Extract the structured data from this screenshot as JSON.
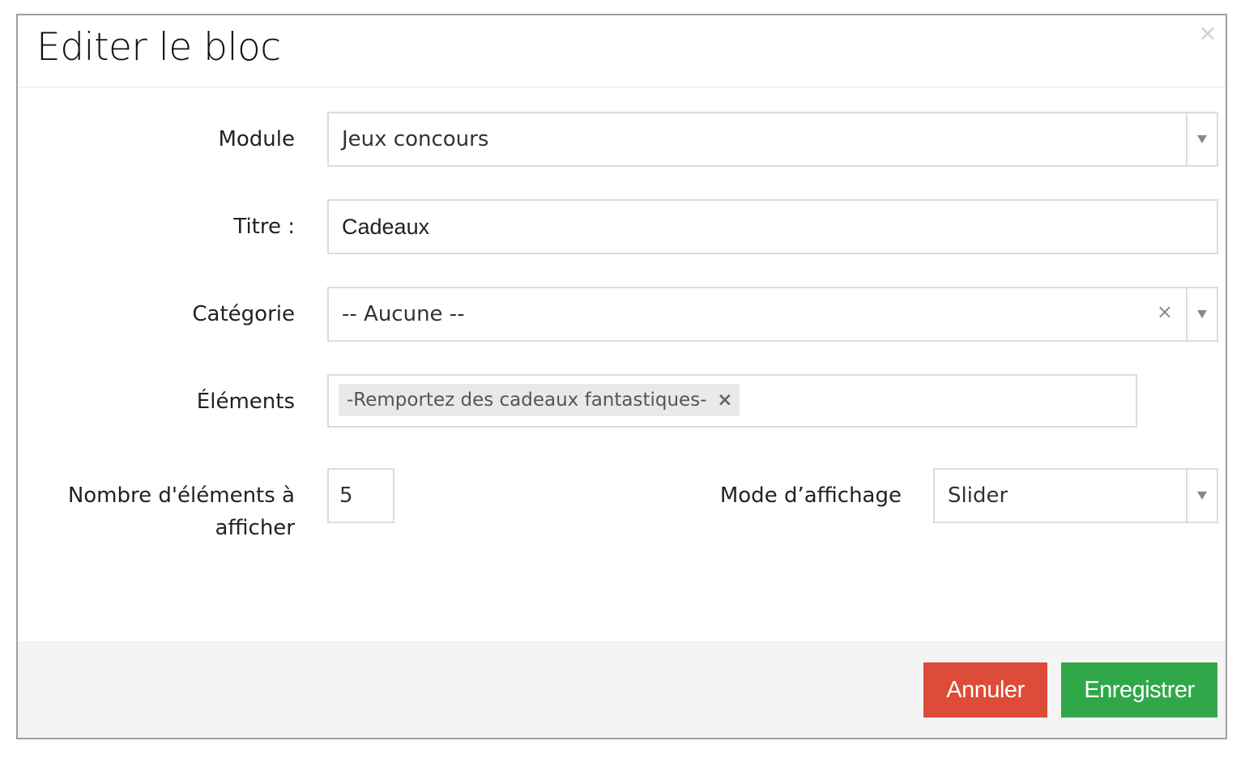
{
  "dialog": {
    "title": "Editer le bloc",
    "close_label": "×"
  },
  "form": {
    "module": {
      "label": "Module",
      "value": "Jeux concours"
    },
    "titre": {
      "label": "Titre :",
      "value": "Cadeaux"
    },
    "categorie": {
      "label": "Catégorie",
      "value": "-- Aucune --",
      "clear_label": "×"
    },
    "elements": {
      "label": "Éléments",
      "tags": [
        {
          "text": "-Remportez des cadeaux fantastiques-",
          "remove_label": "×"
        }
      ]
    },
    "nombre": {
      "label_line1": "Nombre d'éléments à",
      "label_line2": "afficher",
      "value": "5"
    },
    "mode": {
      "label": "Mode d’affichage",
      "value": "Slider"
    }
  },
  "footer": {
    "cancel_label": "Annuler",
    "save_label": "Enregistrer"
  },
  "colors": {
    "cancel": "#dd4b39",
    "save": "#30a84a"
  },
  "icons": {
    "close": "close-icon",
    "dropdown": "chevron-down-icon",
    "clear": "clear-icon",
    "tag_remove": "remove-tag-icon"
  }
}
